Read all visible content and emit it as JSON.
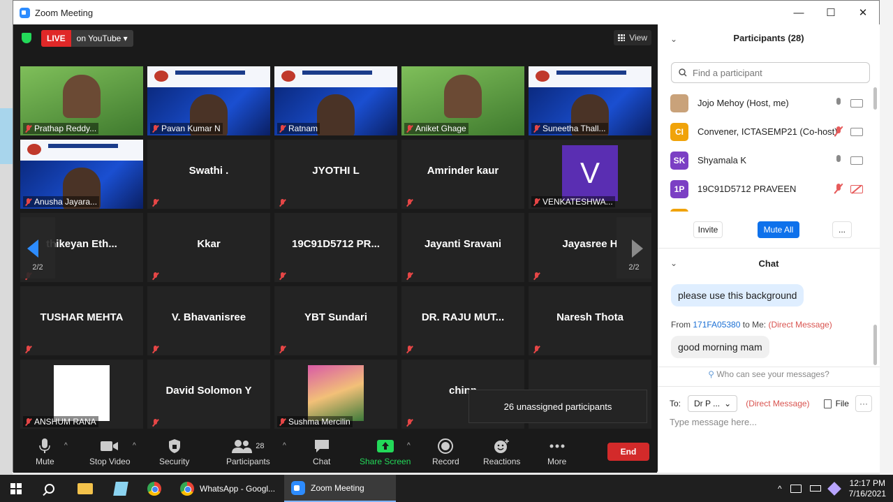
{
  "window": {
    "title": "Zoom Meeting",
    "controls": [
      "—",
      "☐",
      "✕"
    ]
  },
  "video": {
    "live_badge": "LIVE",
    "live_platform": "on YouTube",
    "view_label": "View",
    "page_left": "2/2",
    "page_right": "2/2",
    "tiles": [
      {
        "name": "Prathap Reddy...",
        "kind": "video-green"
      },
      {
        "name": "Pavan Kumar N",
        "kind": "video-banner"
      },
      {
        "name": "Ratnam",
        "kind": "video-banner"
      },
      {
        "name": "Aniket Ghage",
        "kind": "video-green"
      },
      {
        "name": "Suneetha Thall...",
        "kind": "video-banner"
      },
      {
        "name": "Anusha Jayara...",
        "kind": "video-banner"
      },
      {
        "name": "Swathi .",
        "kind": "name"
      },
      {
        "name": "JYOTHI L",
        "kind": "name"
      },
      {
        "name": "Amrinder kaur",
        "kind": "name"
      },
      {
        "name": "VENKATESHWA...",
        "kind": "avatar",
        "avatar": "V"
      },
      {
        "name": "thikeyan  Eth...",
        "kind": "name"
      },
      {
        "name": "Kkar",
        "kind": "name"
      },
      {
        "name": "19C91D5712  PR...",
        "kind": "name"
      },
      {
        "name": "Jayanti Sravani",
        "kind": "name"
      },
      {
        "name": "Jayasree H",
        "kind": "name"
      },
      {
        "name": "TUSHAR MEHTA",
        "kind": "name"
      },
      {
        "name": "V. Bhavanisree",
        "kind": "name"
      },
      {
        "name": "YBT Sundari",
        "kind": "name"
      },
      {
        "name": "DR. RAJU MUT...",
        "kind": "name"
      },
      {
        "name": "Naresh Thota",
        "kind": "name"
      },
      {
        "name": "ANSHUM RANA",
        "kind": "white"
      },
      {
        "name": "David Solomon Y",
        "kind": "name"
      },
      {
        "name": "Sushma Mercilin",
        "kind": "photo"
      },
      {
        "name": "chinn",
        "kind": "name"
      },
      {
        "name": "",
        "kind": "empty"
      }
    ],
    "toast": "26 unassigned participants"
  },
  "toolbar": {
    "mute": "Mute",
    "stop_video": "Stop Video",
    "security": "Security",
    "participants": "Participants",
    "participants_count": "28",
    "chat": "Chat",
    "share_screen": "Share Screen",
    "record": "Record",
    "reactions": "Reactions",
    "more": "More",
    "end": "End"
  },
  "participants_panel": {
    "title": "Participants (28)",
    "search_placeholder": "Find a participant",
    "list": [
      {
        "initials": "",
        "name": "Jojo Mehoy (Host, me)",
        "color": "#c9a27a",
        "mic": "on",
        "cam": "on"
      },
      {
        "initials": "CI",
        "name": "Convener, ICTASEMP21 (Co-host)",
        "color": "#f0a30a",
        "mic": "off",
        "cam": "on"
      },
      {
        "initials": "SK",
        "name": "Shyamala K",
        "color": "#7b3fc4",
        "mic": "on",
        "cam": "on"
      },
      {
        "initials": "1P",
        "name": "19C91D5712 PRAVEEN",
        "color": "#7b3fc4",
        "mic": "off",
        "cam": "off"
      },
      {
        "initials": "",
        "name": "",
        "color": "#f0a30a",
        "mic": "off",
        "cam": "off"
      }
    ],
    "invite": "Invite",
    "mute_all": "Mute All",
    "more": "..."
  },
  "chat_panel": {
    "title": "Chat",
    "message1": "please use this background",
    "from_label": "From",
    "from_user": "171FA05380",
    "to_me": "to Me:",
    "dm_tag": "(Direct Message)",
    "message2": "good morning  mam",
    "who_can_see": "Who can see your messages?",
    "to_label": "To:",
    "to_value": "Dr P ...",
    "to_dm": "(Direct Message)",
    "file": "File",
    "more": "···",
    "input_placeholder": "Type message here..."
  },
  "taskbar": {
    "apps": [
      {
        "label": "WhatsApp - Googl...",
        "active": false
      },
      {
        "label": "Zoom Meeting",
        "active": true
      }
    ],
    "time": "12:17 PM",
    "date": "7/16/2021"
  }
}
